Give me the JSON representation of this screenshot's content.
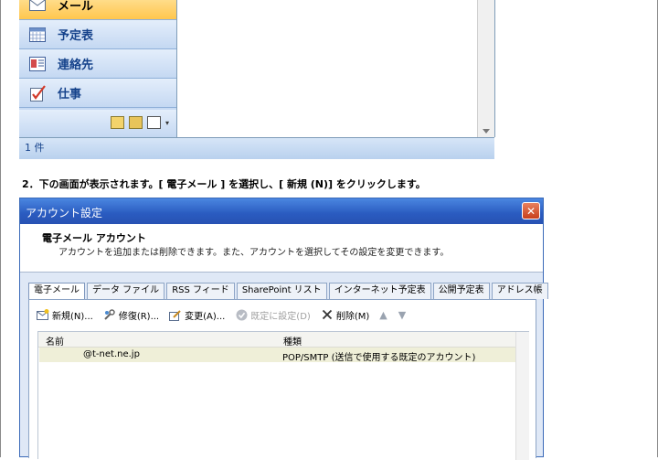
{
  "outlook": {
    "nav_items": [
      {
        "label": "メール",
        "icon": "mail-icon",
        "selected": true
      },
      {
        "label": "予定表",
        "icon": "calendar-icon",
        "selected": false
      },
      {
        "label": "連絡先",
        "icon": "contacts-icon",
        "selected": false
      },
      {
        "label": "仕事",
        "icon": "tasks-icon",
        "selected": false
      }
    ],
    "status_count": "1 件"
  },
  "instruction": "2．下の画面が表示されます。[ 電子メール ] を選択し、[ 新規 (N)] をクリックします。",
  "dialog": {
    "title": "アカウント設定",
    "close_glyph": "✕",
    "header_title": "電子メール アカウント",
    "header_desc": "アカウントを追加または削除できます。また、アカウントを選択してその設定を変更できます。",
    "tabs": [
      "電子メール",
      "データ ファイル",
      "RSS フィード",
      "SharePoint リスト",
      "インターネット予定表",
      "公開予定表",
      "アドレス帳"
    ],
    "active_tab": 0,
    "toolbar": {
      "new": "新規(N)...",
      "repair": "修復(R)...",
      "change": "変更(A)...",
      "set_default": "既定に設定(D)",
      "delete": "削除(M)"
    },
    "list": {
      "col_name": "名前",
      "col_type": "種類",
      "rows": [
        {
          "name": "@t-net.ne.jp",
          "type": "POP/SMTP (送信で使用する既定のアカウント)"
        }
      ]
    }
  },
  "colors": {
    "titlebar": "#2a5bc0",
    "nav_selected": "#ffc64d",
    "nav_bg": "#c4d8f2",
    "close_button": "#c83f1c"
  }
}
